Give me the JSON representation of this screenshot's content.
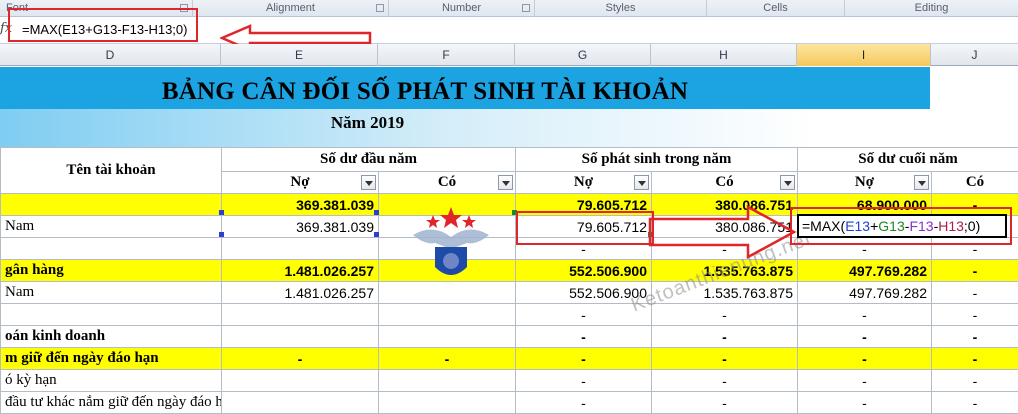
{
  "ribbon": {
    "groups": [
      {
        "label": "Font"
      },
      {
        "label": "Alignment"
      },
      {
        "label": "Number"
      },
      {
        "label": "Styles"
      },
      {
        "label": "Cells"
      },
      {
        "label": "Editing"
      }
    ]
  },
  "formula_bar": {
    "fx_symbol": "fx",
    "formula": "=MAX(E13+G13-F13-H13;0)"
  },
  "columns": [
    {
      "label": "D"
    },
    {
      "label": "E"
    },
    {
      "label": "F"
    },
    {
      "label": "G"
    },
    {
      "label": "H"
    },
    {
      "label": "I"
    },
    {
      "label": "J"
    }
  ],
  "sheet": {
    "title": "BẢNG CÂN ĐỐI SỐ PHÁT SINH TÀI KHOẢN",
    "year": "Năm 2019",
    "header": {
      "account_name": "Tên tài khoản",
      "opening": "Số dư đầu năm",
      "period": "Số phát sinh trong năm",
      "closing": "Số dư cuối năm",
      "debit": "Nợ",
      "credit": "Có"
    },
    "rows": [
      {
        "name": "",
        "e": "369.381.039",
        "f": "",
        "g": "79.605.712",
        "h": "380.086.751",
        "i": "68.900.000",
        "j": "-",
        "yellow": true,
        "bold": true
      },
      {
        "name": "Nam",
        "e": "369.381.039",
        "f": "",
        "g": "79.605.712",
        "h": "380.086.751",
        "i": "",
        "j": "",
        "yellow": false,
        "bold": false
      },
      {
        "name": "",
        "e": "",
        "f": "",
        "g": "-",
        "h": "-",
        "i": "-",
        "j": "-",
        "yellow": false,
        "bold": false
      },
      {
        "name": "gân hàng",
        "e": "1.481.026.257",
        "f": "",
        "g": "552.506.900",
        "h": "1.535.763.875",
        "i": "497.769.282",
        "j": "-",
        "yellow": true,
        "bold": true
      },
      {
        "name": "Nam",
        "e": "1.481.026.257",
        "f": "",
        "g": "552.506.900",
        "h": "1.535.763.875",
        "i": "497.769.282",
        "j": "-",
        "yellow": false,
        "bold": false
      },
      {
        "name": "",
        "e": "",
        "f": "",
        "g": "-",
        "h": "-",
        "i": "-",
        "j": "-",
        "yellow": false,
        "bold": false
      },
      {
        "name": "oán kinh doanh",
        "e": "",
        "f": "",
        "g": "-",
        "h": "-",
        "i": "-",
        "j": "-",
        "yellow": false,
        "bold": true
      },
      {
        "name": "m giữ đến ngày đáo hạn",
        "e": "-",
        "f": "-",
        "g": "-",
        "h": "-",
        "i": "-",
        "j": "-",
        "yellow": true,
        "bold": true
      },
      {
        "name": "ó kỳ hạn",
        "e": "",
        "f": "",
        "g": "-",
        "h": "-",
        "i": "-",
        "j": "-",
        "yellow": false,
        "bold": false
      },
      {
        "name": "đầu tư khác nắm giữ đến ngày đáo hạn",
        "e": "",
        "f": "",
        "g": "-",
        "h": "-",
        "i": "-",
        "j": "-",
        "yellow": false,
        "bold": false
      }
    ]
  },
  "edit_cell": {
    "prefix": "=MAX(",
    "ref1": "E13",
    "op1": "+",
    "ref2": "G13",
    "op2": "-",
    "ref3": "F13",
    "op3": "-",
    "ref4": "H13",
    "suffix": ";0)",
    "colors": {
      "ref1": "#1f3fd8",
      "ref2": "#1b8a2a",
      "ref3": "#8b2fc9",
      "ref4": "#a8204a"
    }
  },
  "watermark": "Ketoanthienung.net",
  "colors": {
    "highlight": "#e0262a",
    "title_band": "#1ba3e2",
    "total_row": "#ffff00"
  }
}
